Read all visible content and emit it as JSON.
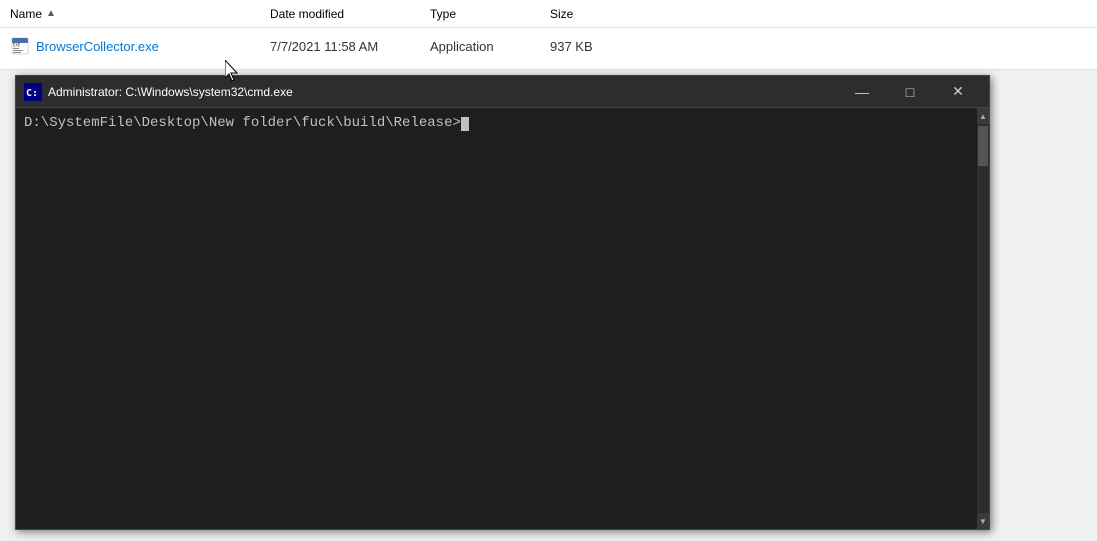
{
  "file_explorer": {
    "columns": {
      "name": "Name",
      "date_modified": "Date modified",
      "type": "Type",
      "size": "Size"
    },
    "sort_column": "name",
    "sort_direction": "asc",
    "files": [
      {
        "name": "BrowserCollector.exe",
        "date_modified": "7/7/2021 11:58 AM",
        "type": "Application",
        "size": "937 KB",
        "icon": "exe"
      }
    ]
  },
  "cmd_window": {
    "title": "Administrator: C:\\Windows\\system32\\cmd.exe",
    "icon": "cmd",
    "prompt": "D:\\SystemFile\\Desktop\\New folder\\fuck\\build\\Release>",
    "buttons": {
      "minimize": "—",
      "maximize": "□",
      "close": "✕"
    }
  }
}
